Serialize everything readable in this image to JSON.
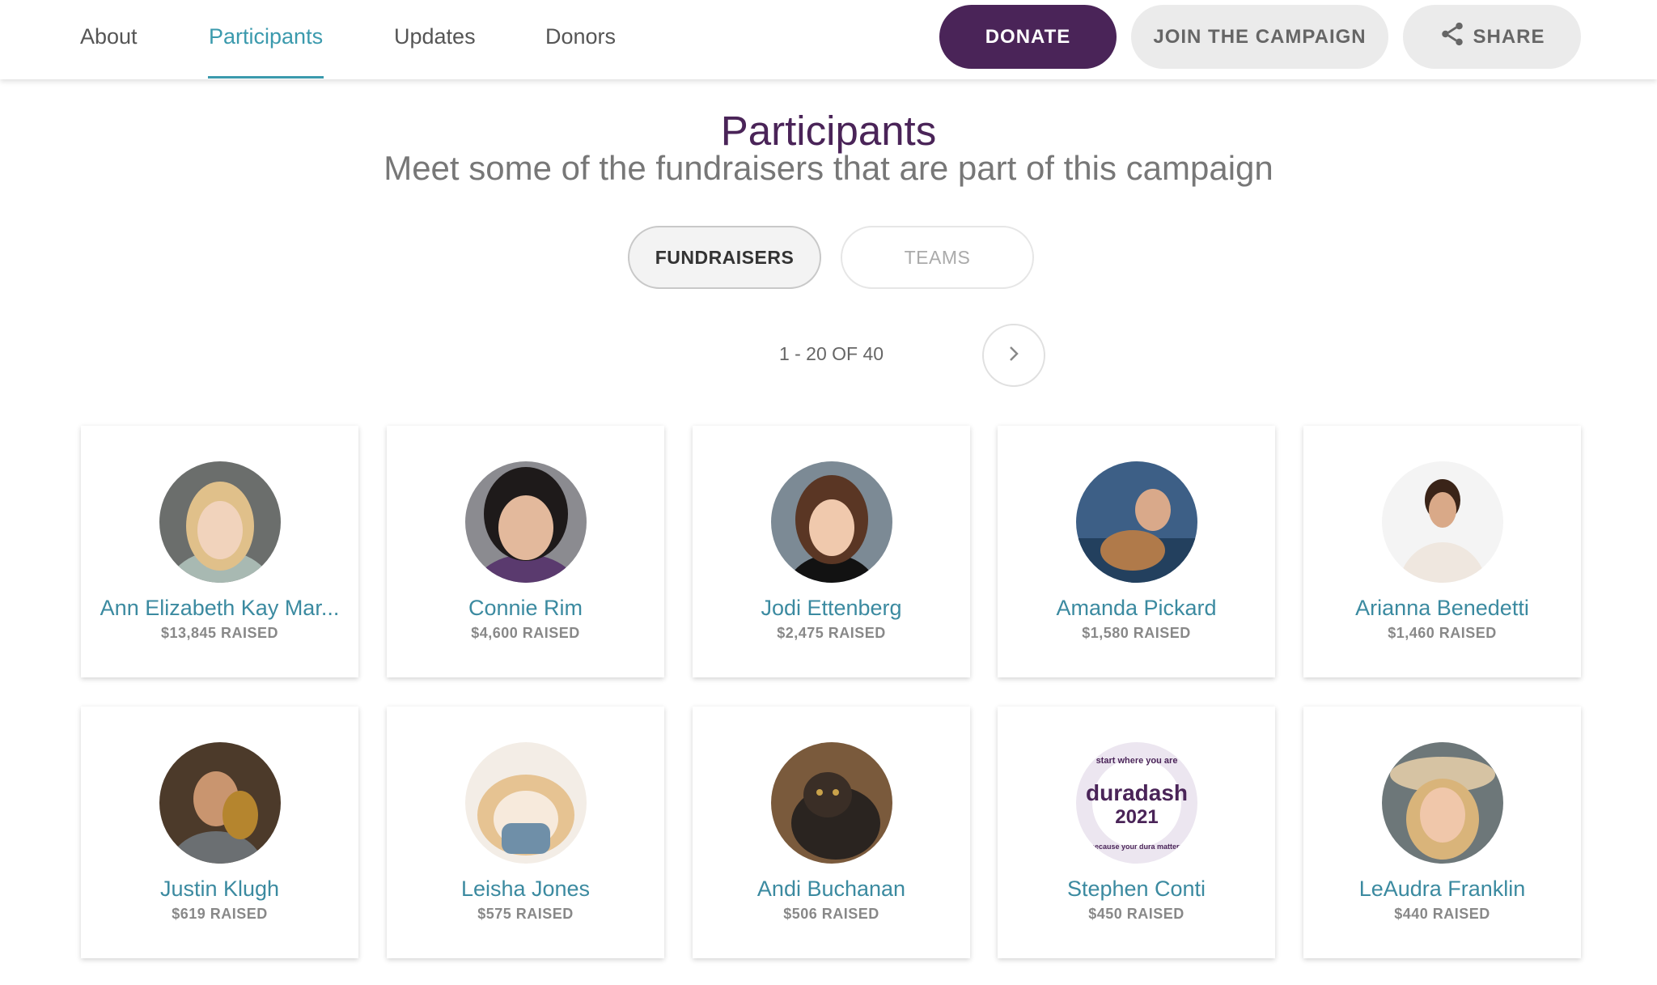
{
  "nav": {
    "tabs": [
      {
        "label": "About"
      },
      {
        "label": "Participants"
      },
      {
        "label": "Updates"
      },
      {
        "label": "Donors"
      }
    ],
    "active_tab": "Participants",
    "donate_label": "DONATE",
    "join_label": "JOIN THE CAMPAIGN",
    "share_label": "SHARE"
  },
  "header": {
    "title": "Participants",
    "subtitle": "Meet some of the fundraisers that are part of this campaign"
  },
  "toggle": {
    "fundraisers_label": "FUNDRAISERS",
    "teams_label": "TEAMS",
    "active": "FUNDRAISERS"
  },
  "pagination": {
    "text": "1 - 20 OF 40"
  },
  "cards": [
    {
      "name": "Ann Elizabeth Kay Mar...",
      "raised": "$13,845 RAISED"
    },
    {
      "name": "Connie Rim",
      "raised": "$4,600 RAISED"
    },
    {
      "name": "Jodi Ettenberg",
      "raised": "$2,475 RAISED"
    },
    {
      "name": "Amanda Pickard",
      "raised": "$1,580 RAISED"
    },
    {
      "name": "Arianna Benedetti",
      "raised": "$1,460 RAISED"
    },
    {
      "name": "Justin Klugh",
      "raised": "$619 RAISED"
    },
    {
      "name": "Leisha Jones",
      "raised": "$575 RAISED"
    },
    {
      "name": "Andi Buchanan",
      "raised": "$506 RAISED"
    },
    {
      "name": "Stephen Conti",
      "raised": "$450 RAISED"
    },
    {
      "name": "LeAudra Franklin",
      "raised": "$440 RAISED"
    }
  ],
  "logo": {
    "top_text": "start where you are",
    "brand": "duradash",
    "year": "2021",
    "bottom_text": "because your dura matters"
  },
  "colors": {
    "primary": "#4a2458",
    "accent": "#3b9aad",
    "name": "#3b8aa0"
  }
}
